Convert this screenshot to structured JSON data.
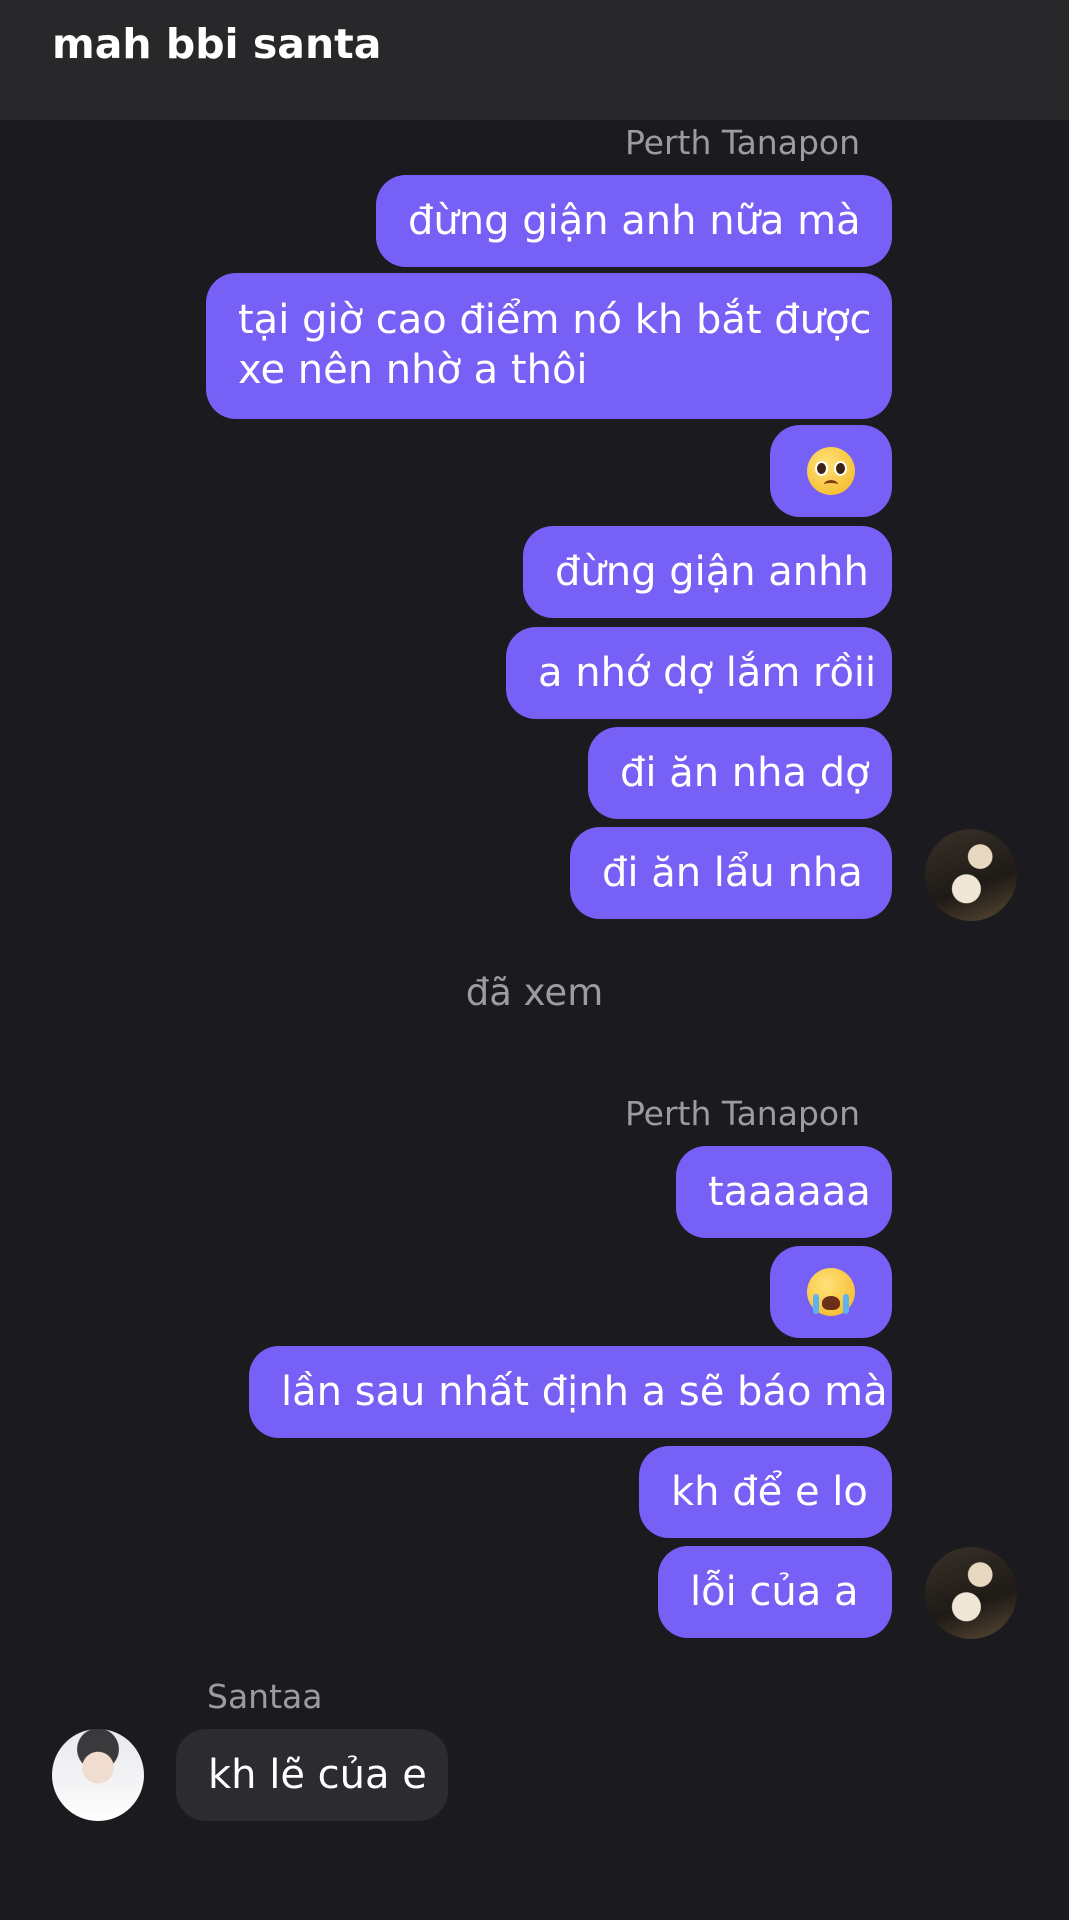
{
  "header": {
    "title": "mah bbi santa"
  },
  "groups": [
    {
      "sender": "Perth Tanapon",
      "messages": [
        "đừng giận anh nữa mà",
        "tại giờ cao điểm nó kh bắt được",
        "xe nên nhờ a thôi",
        "pleading-face-emoji",
        "đừng giận anhh",
        "a nhớ dợ lắm rồii",
        "đi ăn nha dợ",
        "đi ăn lẩu nha"
      ]
    },
    {
      "sender": "Perth Tanapon",
      "messages": [
        "taaaaaa",
        "loudly-crying-face-emoji",
        "lần sau nhất định a sẽ báo mà",
        "kh để e lo",
        "lỗi của a"
      ]
    },
    {
      "sender": "Santaa",
      "messages": [
        "kh lẽ của e"
      ]
    }
  ],
  "status": {
    "seen": "đã xem"
  },
  "colors": {
    "outgoing_bubble": "#7760f5",
    "incoming_bubble": "#2c2b30",
    "background": "#1b1a1f"
  }
}
